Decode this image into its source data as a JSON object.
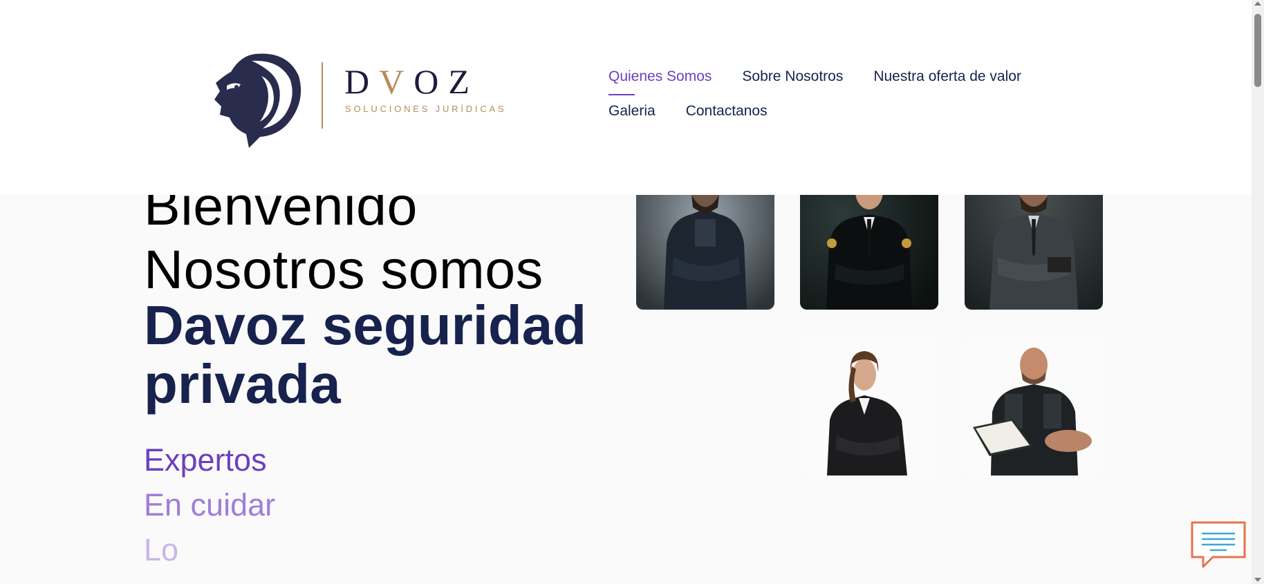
{
  "header": {
    "logo": {
      "wordmark_left": "D",
      "wordmark_accent": "V",
      "wordmark_right": "OZ",
      "tagline": "SOLUCIONES JURÍDICAS",
      "icon": "lion-head-icon"
    },
    "nav": {
      "items": [
        {
          "label": "Quienes Somos",
          "active": true
        },
        {
          "label": "Sobre Nosotros",
          "active": false
        },
        {
          "label": "Nuestra oferta de valor",
          "active": false
        },
        {
          "label": "Galeria",
          "active": false
        },
        {
          "label": "Contactanos",
          "active": false
        }
      ]
    }
  },
  "hero": {
    "welcome": "Bienvenido",
    "we_are": "Nosotros somos",
    "company_line1": "Davoz seguridad",
    "company_line2": "privada",
    "rotating": [
      "Expertos",
      "En cuidar",
      "Lo"
    ]
  },
  "gallery": {
    "images": [
      "security-guard-photo",
      "security-guard-photo",
      "security-guard-photo",
      "female-security-guard-photo",
      "security-guard-writing-photo"
    ]
  },
  "chat_widget": {
    "icon": "chat-bubble-icon"
  },
  "colors": {
    "navy": "#17224e",
    "purple": "#6b3fbf",
    "purple_light": "#9f7ed8",
    "purple_lighter": "#c8b6ea",
    "gold": "#b68b5a",
    "chat_orange": "#e8724c",
    "chat_blue": "#3aa8d8"
  }
}
